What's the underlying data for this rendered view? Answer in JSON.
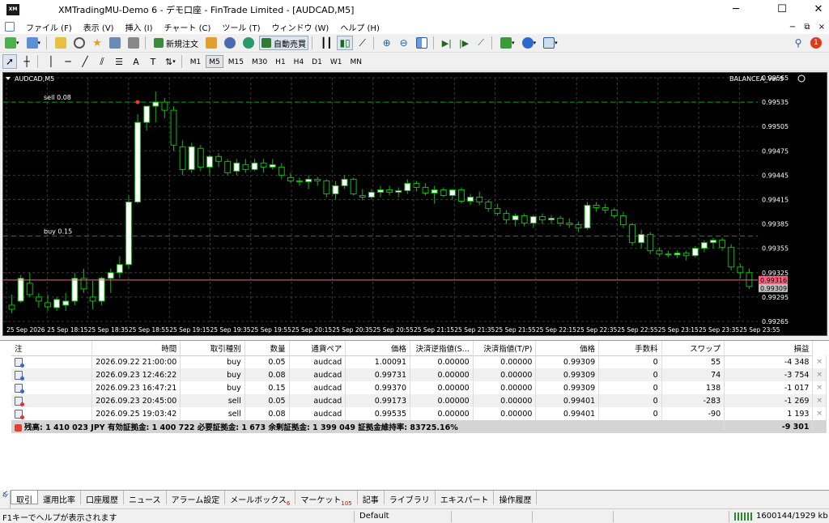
{
  "window": {
    "title": "XMTradingMU-Demo 6 - デモ口座 - FinTrade Limited - [AUDCAD,M5]",
    "app_icon": "XM"
  },
  "menu": {
    "items": [
      "ファイル (F)",
      "表示 (V)",
      "挿入 (I)",
      "チャート (C)",
      "ツール (T)",
      "ウィンドウ (W)",
      "ヘルプ (H)"
    ],
    "notification_count": "1"
  },
  "toolbar": {
    "new_order": "新規注文",
    "auto_trade": "自動売買"
  },
  "timeframes": [
    "M1",
    "M5",
    "M15",
    "M30",
    "H1",
    "H4",
    "D1",
    "W1",
    "MN"
  ],
  "active_timeframe": "M5",
  "chart": {
    "symbol_label": "AUDCAD,M5",
    "indicator_label": "BALANCEA_Ver.5",
    "sell_line_label": "sell 0.08",
    "buy_line_label": "buy 0.15",
    "bid_label": "0.99316",
    "ask_label": "0.99309",
    "colors": {
      "background": "#000000",
      "bull": "#ffffff",
      "bear": "#000000",
      "wick": "#00c000",
      "grid": "#3a3a3a",
      "bid_line": "#ff6080",
      "level_line": "#00a000"
    }
  },
  "chart_data": {
    "type": "candlestick",
    "symbol": "AUDCAD",
    "timeframe": "M5",
    "ylim": [
      0.99265,
      0.99565
    ],
    "y_ticks": [
      "0.99565",
      "0.99535",
      "0.99505",
      "0.99475",
      "0.99445",
      "0.99415",
      "0.99385",
      "0.99355",
      "0.99325",
      "0.99295",
      "0.99265"
    ],
    "x_ticks": [
      "25 Sep 2026",
      "25 Sep 18:15",
      "25 Sep 18:35",
      "25 Sep 18:55",
      "25 Sep 19:15",
      "25 Sep 19:35",
      "25 Sep 19:55",
      "25 Sep 20:15",
      "25 Sep 20:35",
      "25 Sep 20:55",
      "25 Sep 21:15",
      "25 Sep 21:35",
      "25 Sep 21:55",
      "25 Sep 22:15",
      "25 Sep 22:35",
      "25 Sep 22:55",
      "25 Sep 23:15",
      "25 Sep 23:35",
      "25 Sep 23:55"
    ],
    "levels": [
      {
        "name": "sell 0.08",
        "value": 0.99535
      },
      {
        "name": "buy 0.15",
        "value": 0.9937
      }
    ],
    "bid": 0.99316,
    "candles": [
      [
        0.99285,
        0.99298,
        0.99275,
        0.9928
      ],
      [
        0.9929,
        0.99322,
        0.99288,
        0.99318
      ],
      [
        0.99312,
        0.99325,
        0.99295,
        0.99298
      ],
      [
        0.99295,
        0.993,
        0.99282,
        0.9929
      ],
      [
        0.99288,
        0.99298,
        0.99278,
        0.99283
      ],
      [
        0.99282,
        0.99295,
        0.99278,
        0.99292
      ],
      [
        0.99285,
        0.993,
        0.99278,
        0.9929
      ],
      [
        0.9929,
        0.99325,
        0.99285,
        0.99318
      ],
      [
        0.99318,
        0.9933,
        0.993,
        0.99305
      ],
      [
        0.99295,
        0.99315,
        0.9928,
        0.9929
      ],
      [
        0.9929,
        0.9932,
        0.99285,
        0.99318
      ],
      [
        0.99318,
        0.9933,
        0.993,
        0.99325
      ],
      [
        0.99325,
        0.99345,
        0.99318,
        0.99335
      ],
      [
        0.99335,
        0.9942,
        0.9933,
        0.99412
      ],
      [
        0.99412,
        0.9952,
        0.9941,
        0.9951
      ],
      [
        0.9951,
        0.99525,
        0.995,
        0.9953
      ],
      [
        0.9953,
        0.99548,
        0.9951,
        0.99535
      ],
      [
        0.99535,
        0.9954,
        0.99515,
        0.99525
      ],
      [
        0.99525,
        0.9953,
        0.99475,
        0.99482
      ],
      [
        0.9948,
        0.99488,
        0.99445,
        0.99452
      ],
      [
        0.99452,
        0.99485,
        0.99448,
        0.9948
      ],
      [
        0.99478,
        0.99482,
        0.9945,
        0.99455
      ],
      [
        0.99455,
        0.9947,
        0.99445,
        0.99468
      ],
      [
        0.99468,
        0.99472,
        0.99455,
        0.99462
      ],
      [
        0.99462,
        0.99465,
        0.99445,
        0.99448
      ],
      [
        0.9945,
        0.99465,
        0.99445,
        0.9946
      ],
      [
        0.99458,
        0.99465,
        0.99448,
        0.99452
      ],
      [
        0.99452,
        0.99465,
        0.9945,
        0.9946
      ],
      [
        0.9946,
        0.99465,
        0.99448,
        0.99455
      ],
      [
        0.99455,
        0.99465,
        0.99452,
        0.99458
      ],
      [
        0.99455,
        0.9946,
        0.9944,
        0.99445
      ],
      [
        0.99442,
        0.99448,
        0.99435,
        0.99438
      ],
      [
        0.99438,
        0.99442,
        0.99432,
        0.99437
      ],
      [
        0.99437,
        0.99445,
        0.99428,
        0.9944
      ],
      [
        0.9944,
        0.99443,
        0.99432,
        0.99438
      ],
      [
        0.99438,
        0.9944,
        0.99418,
        0.99422
      ],
      [
        0.99422,
        0.99438,
        0.99415,
        0.99432
      ],
      [
        0.99432,
        0.99445,
        0.99428,
        0.9944
      ],
      [
        0.9944,
        0.99442,
        0.9942,
        0.99422
      ],
      [
        0.9942,
        0.99428,
        0.99414,
        0.99418
      ],
      [
        0.99418,
        0.99428,
        0.99415,
        0.99424
      ],
      [
        0.99424,
        0.99432,
        0.99418,
        0.99427
      ],
      [
        0.99427,
        0.99432,
        0.9942,
        0.99424
      ],
      [
        0.99424,
        0.9943,
        0.99418,
        0.99426
      ],
      [
        0.99426,
        0.9944,
        0.99422,
        0.99435
      ],
      [
        0.99435,
        0.99438,
        0.99425,
        0.9943
      ],
      [
        0.9943,
        0.99435,
        0.9942,
        0.99423
      ],
      [
        0.99423,
        0.99432,
        0.9941,
        0.99427
      ],
      [
        0.99427,
        0.9943,
        0.99418,
        0.9942
      ],
      [
        0.9942,
        0.99428,
        0.99415,
        0.99427
      ],
      [
        0.99427,
        0.9943,
        0.9941,
        0.99413
      ],
      [
        0.99413,
        0.99422,
        0.99408,
        0.99418
      ],
      [
        0.99418,
        0.99425,
        0.99408,
        0.99412
      ],
      [
        0.99412,
        0.99415,
        0.994,
        0.99404
      ],
      [
        0.99404,
        0.9941,
        0.99395,
        0.99398
      ],
      [
        0.99398,
        0.99402,
        0.99385,
        0.9939
      ],
      [
        0.9939,
        0.99398,
        0.99382,
        0.99395
      ],
      [
        0.99395,
        0.99398,
        0.99382,
        0.99386
      ],
      [
        0.99386,
        0.99396,
        0.9938,
        0.99394
      ],
      [
        0.99394,
        0.99398,
        0.99385,
        0.9939
      ],
      [
        0.9939,
        0.99396,
        0.99385,
        0.99392
      ],
      [
        0.99392,
        0.99395,
        0.99382,
        0.99386
      ],
      [
        0.99386,
        0.99392,
        0.9938,
        0.99384
      ],
      [
        0.99384,
        0.99388,
        0.99375,
        0.9938
      ],
      [
        0.9938,
        0.99412,
        0.99378,
        0.99408
      ],
      [
        0.99408,
        0.99412,
        0.994,
        0.99405
      ],
      [
        0.99405,
        0.9941,
        0.99398,
        0.99402
      ],
      [
        0.99402,
        0.99405,
        0.99392,
        0.99395
      ],
      [
        0.99395,
        0.994,
        0.9938,
        0.99384
      ],
      [
        0.99384,
        0.99386,
        0.99358,
        0.99362
      ],
      [
        0.99362,
        0.99378,
        0.99355,
        0.99372
      ],
      [
        0.99372,
        0.99375,
        0.99348,
        0.99352
      ],
      [
        0.99352,
        0.99356,
        0.99345,
        0.99348
      ],
      [
        0.99348,
        0.99352,
        0.99344,
        0.99347
      ],
      [
        0.99347,
        0.99352,
        0.99343,
        0.99349
      ],
      [
        0.99349,
        0.99352,
        0.9934,
        0.99346
      ],
      [
        0.99346,
        0.99358,
        0.99344,
        0.99355
      ],
      [
        0.99355,
        0.99365,
        0.9935,
        0.99362
      ],
      [
        0.99362,
        0.99368,
        0.99355,
        0.99365
      ],
      [
        0.99365,
        0.99368,
        0.99352,
        0.99356
      ],
      [
        0.99356,
        0.9936,
        0.99328,
        0.99332
      ],
      [
        0.99332,
        0.99336,
        0.99318,
        0.99325
      ],
      [
        0.99325,
        0.9933,
        0.99305,
        0.99308
      ]
    ]
  },
  "terminal": {
    "side_label": "ターミナル",
    "columns": [
      "注",
      "時間",
      "取引種別",
      "数量",
      "通貨ペア",
      "価格",
      "決済逆指値(S...",
      "決済指値(T/P)",
      "価格",
      "手数料",
      "スワップ",
      "損益"
    ],
    "rows": [
      {
        "order": "",
        "time": "2026.09.22 21:00:00",
        "type": "buy",
        "volume": "0.05",
        "symbol": "audcad",
        "price": "1.00091",
        "sl": "0.00000",
        "tp": "0.00000",
        "cur_price": "0.99309",
        "commission": "0",
        "swap": "55",
        "profit": "-4 348",
        "dir": "buy"
      },
      {
        "order": "",
        "time": "2026.09.23 12:46:22",
        "type": "buy",
        "volume": "0.08",
        "symbol": "audcad",
        "price": "0.99731",
        "sl": "0.00000",
        "tp": "0.00000",
        "cur_price": "0.99309",
        "commission": "0",
        "swap": "74",
        "profit": "-3 754",
        "dir": "buy"
      },
      {
        "order": "",
        "time": "2026.09.23 16:47:21",
        "type": "buy",
        "volume": "0.15",
        "symbol": "audcad",
        "price": "0.99370",
        "sl": "0.00000",
        "tp": "0.00000",
        "cur_price": "0.99309",
        "commission": "0",
        "swap": "138",
        "profit": "-1 017",
        "dir": "buy"
      },
      {
        "order": "",
        "time": "2026.09.23 20:45:00",
        "type": "sell",
        "volume": "0.05",
        "symbol": "audcad",
        "price": "0.99173",
        "sl": "0.00000",
        "tp": "0.00000",
        "cur_price": "0.99401",
        "commission": "0",
        "swap": "-283",
        "profit": "-1 269",
        "dir": "sell"
      },
      {
        "order": "",
        "time": "2026.09.25 19:03:42",
        "type": "sell",
        "volume": "0.08",
        "symbol": "audcad",
        "price": "0.99535",
        "sl": "0.00000",
        "tp": "0.00000",
        "cur_price": "0.99401",
        "commission": "0",
        "swap": "-90",
        "profit": "1 193",
        "dir": "sell"
      }
    ],
    "balance_text": "残高: 1 410 023 JPY  有効証拠金: 1 400 722  必要証拠金: 1 673  余剰証拠金: 1 399 049  証拠金維持率: 83725.16%",
    "total_profit": "-9 301"
  },
  "tabs": [
    {
      "label": "取引",
      "badge": ""
    },
    {
      "label": "運用比率",
      "badge": ""
    },
    {
      "label": "口座履歴",
      "badge": ""
    },
    {
      "label": "ニュース",
      "badge": ""
    },
    {
      "label": "アラーム設定",
      "badge": ""
    },
    {
      "label": "メールボックス",
      "badge": "6"
    },
    {
      "label": "マーケット",
      "badge": "105"
    },
    {
      "label": "記事",
      "badge": ""
    },
    {
      "label": "ライブラリ",
      "badge": ""
    },
    {
      "label": "エキスパート",
      "badge": ""
    },
    {
      "label": "操作履歴",
      "badge": ""
    }
  ],
  "status": {
    "help_text": "F1キーでヘルプが表示されます",
    "profile": "Default",
    "traffic": "1600144/1929 kb"
  }
}
